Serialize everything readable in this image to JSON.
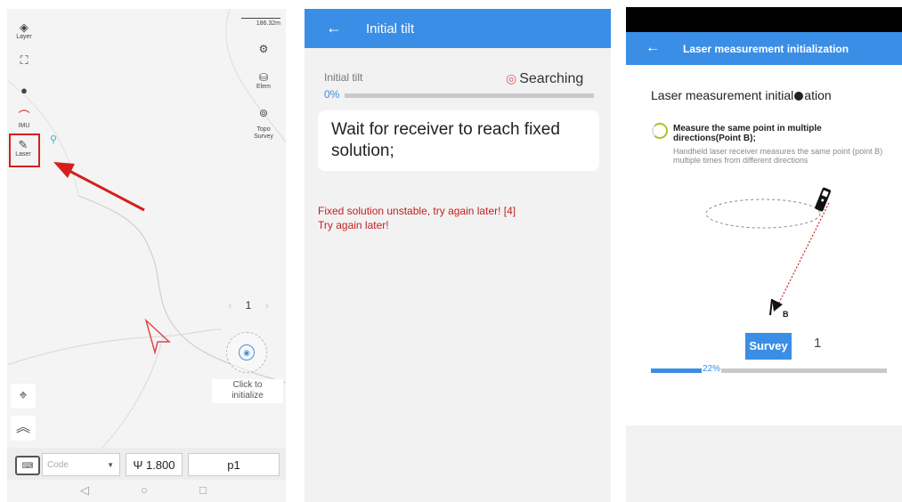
{
  "panel1": {
    "scale_label": "186.32m",
    "left_tools": [
      {
        "label": "Layer",
        "icon": "layers-icon",
        "glyph": "◈"
      },
      {
        "label": "",
        "icon": "fullscreen-icon",
        "glyph": "⛶"
      },
      {
        "label": "",
        "icon": "bomb-icon",
        "glyph": "●"
      },
      {
        "label": "IMU",
        "icon": "imu-icon",
        "glyph": "⌒"
      },
      {
        "label": "Laser",
        "icon": "laser-pen-icon",
        "glyph": "✎"
      }
    ],
    "right_tools": [
      {
        "label": "",
        "icon": "settings-icon",
        "glyph": "⚙"
      },
      {
        "label": "Elem",
        "icon": "database-icon",
        "glyph": "⛁"
      },
      {
        "label": "Topo\nSurvey",
        "icon": "survey-icon",
        "glyph": "⊚"
      }
    ],
    "page_number": "1",
    "click_to_initialize": "Click to\ninitialize",
    "code_placeholder": "Code",
    "antenna_height": "1.800",
    "point_name": "p1",
    "highlight_color": "#d32020"
  },
  "panel2": {
    "title": "Initial tilt",
    "tilt_label": "Initial tilt",
    "status": "Searching",
    "percent": "0%",
    "progress": 0,
    "message": "Wait for receiver to reach fixed solution;",
    "error_line1": "Fixed solution unstable, try again later! [4]",
    "error_line2": "Try again later!",
    "accent": "#3a8ee6"
  },
  "panel3": {
    "title": "Laser measurement initialization",
    "heading_a": "Laser measurement initial",
    "heading_b": "ation",
    "step_title": "Measure the same point in multiple directions(Point B);",
    "step_desc": "Handheld laser receiver measures the same point (point B) multiple times from different directions",
    "point_label": "B",
    "survey_label": "Survey",
    "count": "1",
    "percent": "22%",
    "progress": 0.22
  }
}
